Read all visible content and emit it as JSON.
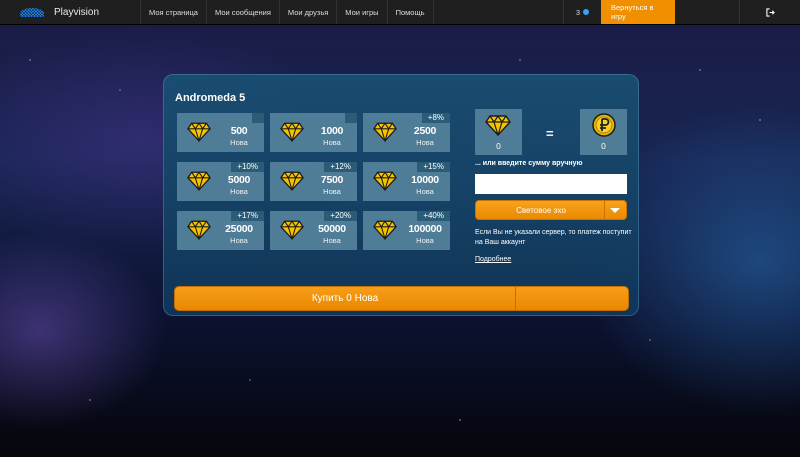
{
  "topbar": {
    "brand": "Playvision",
    "nav": [
      "Моя страница",
      "Мои сообщения",
      "Мои друзья",
      "Мои игры",
      "Помощь"
    ],
    "counter": "3",
    "back_button": "Вернуться в игру",
    "exit_icon": "logout-icon"
  },
  "panel": {
    "title": "Andromeda 5",
    "tiles": [
      {
        "amount": "500",
        "unit": "Нова",
        "bonus": ""
      },
      {
        "amount": "1000",
        "unit": "Нова",
        "bonus": ""
      },
      {
        "amount": "2500",
        "unit": "Нова",
        "bonus": "+8%"
      },
      {
        "amount": "5000",
        "unit": "Нова",
        "bonus": "+10%"
      },
      {
        "amount": "7500",
        "unit": "Нова",
        "bonus": "+12%"
      },
      {
        "amount": "10000",
        "unit": "Нова",
        "bonus": "+15%"
      },
      {
        "amount": "25000",
        "unit": "Нова",
        "bonus": "+17%"
      },
      {
        "amount": "50000",
        "unit": "Нова",
        "bonus": "+20%"
      },
      {
        "amount": "100000",
        "unit": "Нова",
        "bonus": "+40%"
      }
    ],
    "converter": {
      "gems_value": "0",
      "equals": "=",
      "rub_value": "0"
    },
    "manual_label": "... или введите сумму вручную",
    "manual_value": "",
    "server_select": "Световое эхо",
    "note": "Если Вы не указали сервер, то платеж поступит на Ваш аккаунт",
    "more_link": "Подробнее",
    "buy_button": "Купить 0 Нова"
  },
  "colors": {
    "accent": "#f08f00",
    "panel": "#1a5578",
    "tile": "#4f7c96",
    "gem": "#f5c400"
  }
}
